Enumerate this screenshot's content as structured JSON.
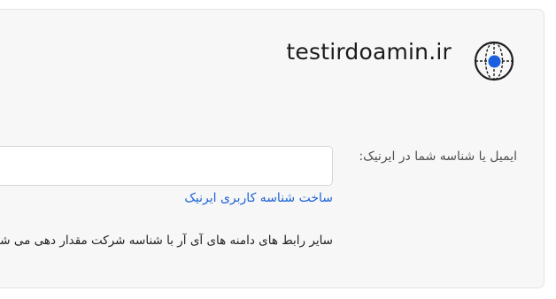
{
  "header": {
    "domain": "testirdoamin.ir",
    "logo_icon": "globe-target-icon",
    "accent_color": "#1a5fe0"
  },
  "form": {
    "identifier_label": "ایمیل یا شناسه شما در ایرنیک:",
    "identifier_value": "",
    "create_account_link": "ساخت شناسه کاربری ایرنیک",
    "info_note": "سایر رابط های دامنه های آی آر با شناسه شرکت مقدار دهی می شود."
  }
}
